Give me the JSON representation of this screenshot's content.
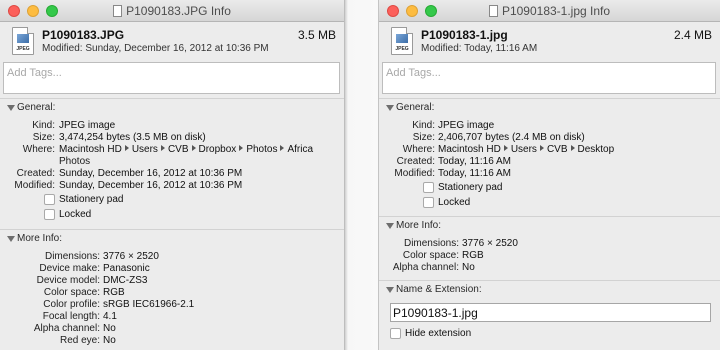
{
  "left_window": {
    "title": "P1090183.JPG Info",
    "file_name": "P1090183.JPG",
    "file_size": "3.5 MB",
    "modified_line": "Modified: Sunday, December 16, 2012 at 10:36 PM",
    "icon_label": "JPEG",
    "tags_placeholder": "Add Tags...",
    "general": {
      "title": "General:",
      "kind_label": "Kind:",
      "kind": "JPEG image",
      "size_label": "Size:",
      "size": "3,474,254 bytes (3.5 MB on disk)",
      "where_label": "Where:",
      "where": [
        "Macintosh HD",
        "Users",
        "CVB",
        "Dropbox",
        "Photos",
        "Africa"
      ],
      "where_wrap": "Photos",
      "created_label": "Created:",
      "created": "Sunday, December 16, 2012 at 10:36 PM",
      "modified_label": "Modified:",
      "modified": "Sunday, December 16, 2012 at 10:36 PM",
      "stationery": "Stationery pad",
      "locked": "Locked"
    },
    "more_info": {
      "title": "More Info:",
      "rows": [
        {
          "label": "Dimensions:",
          "value": "3776 × 2520"
        },
        {
          "label": "Device make:",
          "value": "Panasonic"
        },
        {
          "label": "Device model:",
          "value": "DMC-ZS3"
        },
        {
          "label": "Color space:",
          "value": "RGB"
        },
        {
          "label": "Color profile:",
          "value": "sRGB IEC61966-2.1"
        },
        {
          "label": "Focal length:",
          "value": "4.1"
        },
        {
          "label": "Alpha channel:",
          "value": "No"
        },
        {
          "label": "Red eye:",
          "value": "No"
        }
      ]
    }
  },
  "right_window": {
    "title": "P1090183-1.jpg Info",
    "file_name": "P1090183-1.jpg",
    "file_size": "2.4 MB",
    "modified_line": "Modified: Today, 11:16 AM",
    "icon_label": "JPEG",
    "tags_placeholder": "Add Tags...",
    "general": {
      "title": "General:",
      "kind_label": "Kind:",
      "kind": "JPEG image",
      "size_label": "Size:",
      "size": "2,406,707 bytes (2.4 MB on disk)",
      "where_label": "Where:",
      "where": [
        "Macintosh HD",
        "Users",
        "CVB",
        "Desktop"
      ],
      "created_label": "Created:",
      "created": "Today, 11:16 AM",
      "modified_label": "Modified:",
      "modified": "Today, 11:16 AM",
      "stationery": "Stationery pad",
      "locked": "Locked"
    },
    "more_info": {
      "title": "More Info:",
      "rows": [
        {
          "label": "Dimensions:",
          "value": "3776 × 2520"
        },
        {
          "label": "Color space:",
          "value": "RGB"
        },
        {
          "label": "Alpha channel:",
          "value": "No"
        }
      ]
    },
    "name_ext": {
      "title": "Name & Extension:",
      "value": "P1090183-1.jpg",
      "hide_extension": "Hide extension"
    }
  }
}
